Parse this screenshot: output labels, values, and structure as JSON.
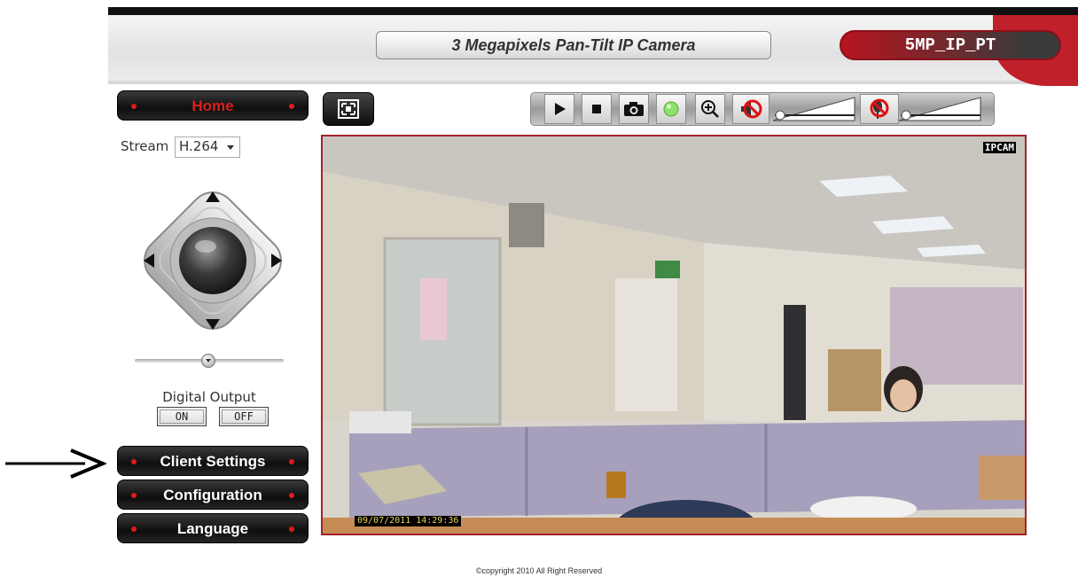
{
  "header": {
    "title": "3 Megapixels Pan-Tilt IP Camera",
    "model": "5MP_IP_PT"
  },
  "menu": {
    "home": "Home",
    "client_settings": "Client Settings",
    "configuration": "Configuration",
    "language": "Language"
  },
  "stream": {
    "label": "Stream",
    "value": "H.264"
  },
  "digital_output": {
    "label": "Digital Output",
    "on": "ON",
    "off": "OFF"
  },
  "toolbar": {
    "icons": [
      "play-icon",
      "stop-icon",
      "snapshot-icon",
      "record-status-icon",
      "zoom-in-icon",
      "speaker-mute-icon",
      "microphone-mute-icon"
    ],
    "status_color": "#8fe06a"
  },
  "video": {
    "osd_label": "IPCAM",
    "timestamp": "09/07/2011 14:29:36"
  },
  "footer": {
    "copyright": "©copyright 2010 All Right Reserved"
  },
  "colors": {
    "accent_red": "#c0202a",
    "video_border": "#a3232a"
  }
}
